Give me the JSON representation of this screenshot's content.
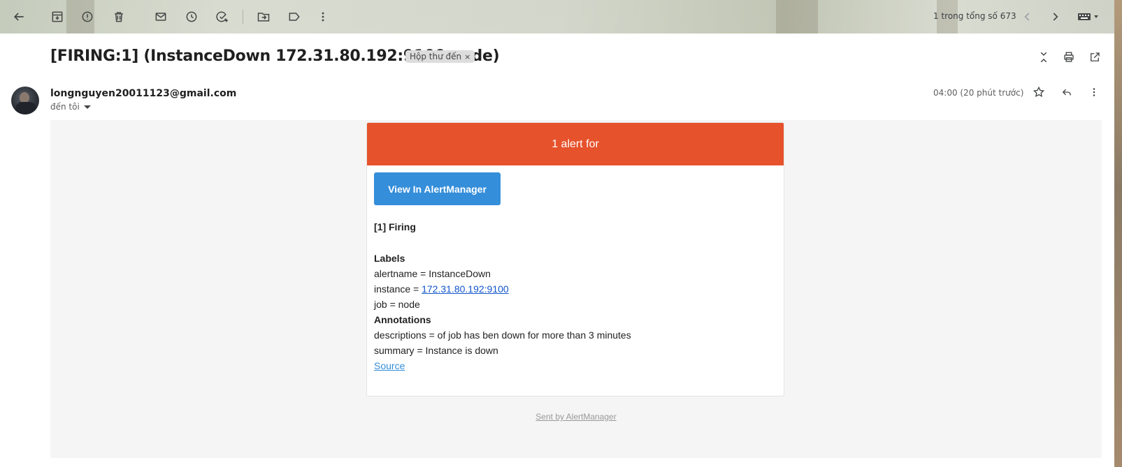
{
  "toolbar": {
    "icons": [
      "back-icon",
      "archive-icon",
      "report-spam-icon",
      "delete-icon",
      "mark-unread-icon",
      "snooze-icon",
      "add-task-icon",
      "move-to-icon",
      "label-icon",
      "more-vert-icon"
    ],
    "pager_text": "1 trong tổng số 673",
    "pager_icons": [
      "chevron-left-icon",
      "chevron-right-icon",
      "keyboard-icon"
    ]
  },
  "message": {
    "subject": "[FIRING:1] (InstanceDown 172.31.80.192:9100 node)",
    "label_chip": "Hộp thư đến",
    "label_chip_close": "×",
    "sender_email": "longnguyen20011123@gmail.com",
    "recipient_text": "đến tôi",
    "timestamp": "04:00 (20 phút trước)"
  },
  "alert_email": {
    "header": "1 alert for",
    "button_label": "View In AlertManager",
    "firing_heading": "[1] Firing",
    "labels_heading": "Labels",
    "label_alertname": "alertname = InstanceDown",
    "label_instance_prefix": "instance = ",
    "label_instance_link": "172.31.80.192:9100",
    "label_job": "job = node",
    "annotations_heading": "Annotations",
    "annotation_descriptions": "descriptions = of job has ben down for more than 3 minutes",
    "annotation_summary": "summary = Instance is down",
    "source_link": "Source",
    "footer": "Sent by AlertManager"
  },
  "colors": {
    "alert_header_bg": "#e6522c",
    "button_bg": "#348eda",
    "link": "#1155cc",
    "body_bg": "#f5f5f5"
  }
}
